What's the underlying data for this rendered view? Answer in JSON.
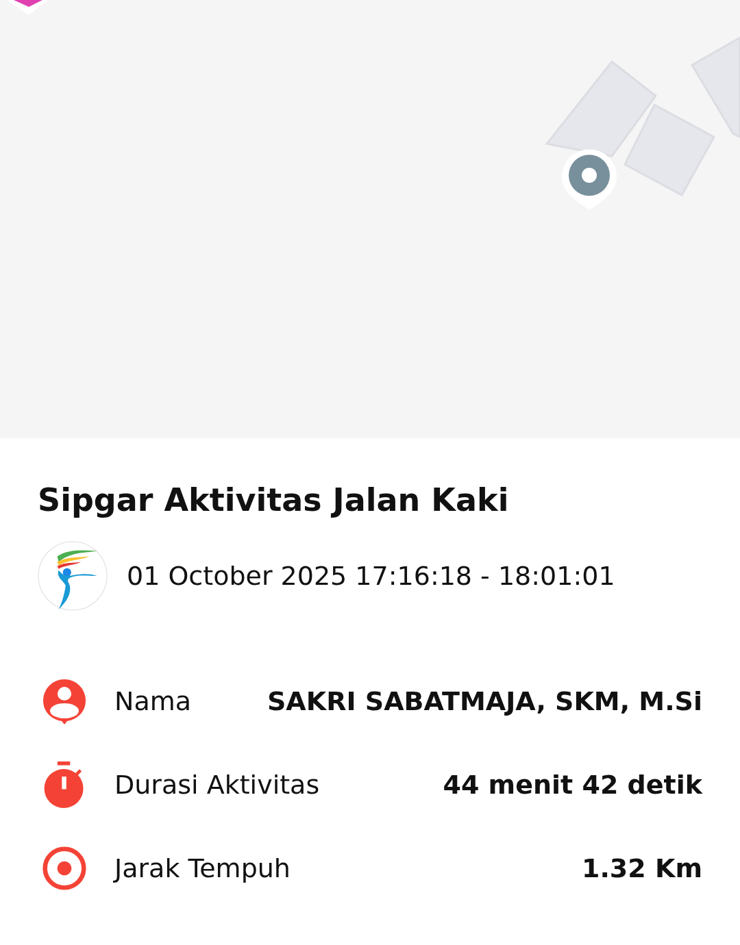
{
  "activity": {
    "title": "Sipgar Aktivitas Jalan Kaki",
    "datetime": "01 October 2025 17:16:18 - 18:01:01"
  },
  "details": [
    {
      "kind": "person",
      "label": "Nama",
      "value": "SAKRI SABATMAJA, SKM, M.Si"
    },
    {
      "kind": "timer",
      "label": "Durasi Aktivitas",
      "value": "44 menit 42 detik"
    },
    {
      "kind": "target",
      "label": "Jarak Tempuh",
      "value": "1.32 Km"
    }
  ]
}
